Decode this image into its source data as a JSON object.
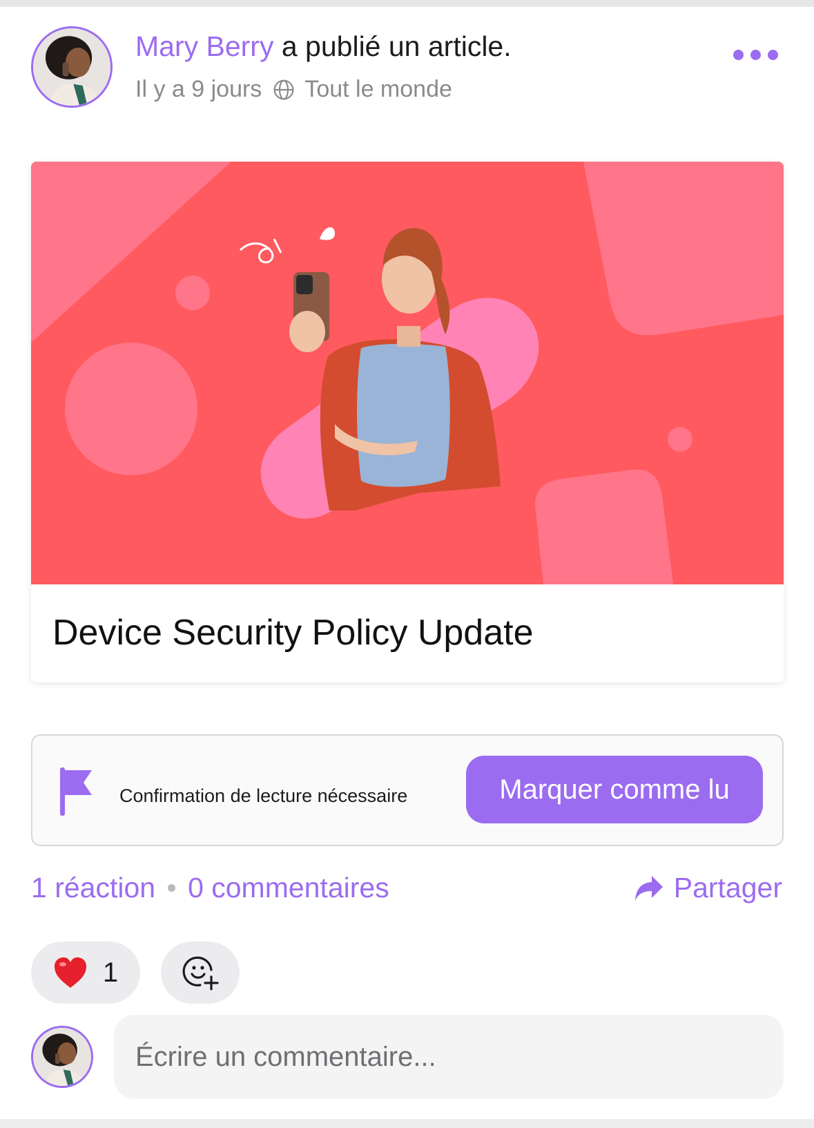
{
  "post": {
    "author_name": "Mary Berry",
    "action_text": " a publié un article.",
    "time_ago": "Il y a 9 jours",
    "audience": "Tout le monde",
    "more_icon": "more-dots-icon",
    "globe_icon": "globe-icon"
  },
  "article": {
    "title": "Device Security Policy Update",
    "hero_bg_color": "#ff5a5f",
    "hero_accent_color": "#ff7da0"
  },
  "read_confirmation": {
    "label": "Confirmation de lecture nécessaire",
    "button_label": "Marquer comme lu",
    "icon": "flag-icon"
  },
  "stats": {
    "reactions": "1 réaction",
    "comments": "0 commentaires",
    "share_label": "Partager",
    "share_icon": "share-arrow-icon"
  },
  "reactions": {
    "heart_icon": "heart-emoji-icon",
    "heart_count": "1",
    "add_icon": "add-reaction-icon"
  },
  "comment": {
    "placeholder": "Écrire un commentaire..."
  },
  "colors": {
    "accent": "#9b6cf0"
  }
}
